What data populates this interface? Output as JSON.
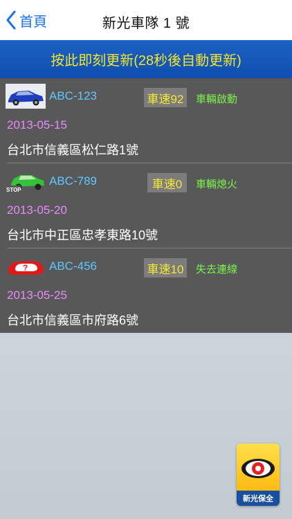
{
  "nav": {
    "back_label": "首頁",
    "title": "新光車隊 1 號"
  },
  "refresh_label": "按此即刻更新(28秒後自動更新)",
  "vehicles": [
    {
      "plate": "ABC-123",
      "speed": "車速92",
      "status": "車輛啟動",
      "date": "2013-05-15",
      "address": "台北市信義區松仁路1號",
      "icon": "blue-car-icon"
    },
    {
      "plate": "ABC-789",
      "speed": "車速0",
      "status": "車輛熄火",
      "date": "2013-05-20",
      "address": "台北市中正區忠孝東路10號",
      "icon": "green-car-stop-icon",
      "stop_label": "STOP"
    },
    {
      "plate": "ABC-456",
      "speed": "車速10",
      "status": "失去連線",
      "date": "2013-05-25",
      "address": "台北市信義區市府路6號",
      "icon": "red-car-unknown-icon"
    }
  ],
  "logo": {
    "text": "新光保全"
  },
  "colors": {
    "accent_blue": "#1a73e8",
    "banner_blue": "#0e4fb0",
    "banner_text": "#f4e52a",
    "list_bg": "#585858",
    "plate_text": "#5fc8ff",
    "speed_text": "#f6e832",
    "status_text": "#7cf24b",
    "date_text": "#e88bff"
  }
}
